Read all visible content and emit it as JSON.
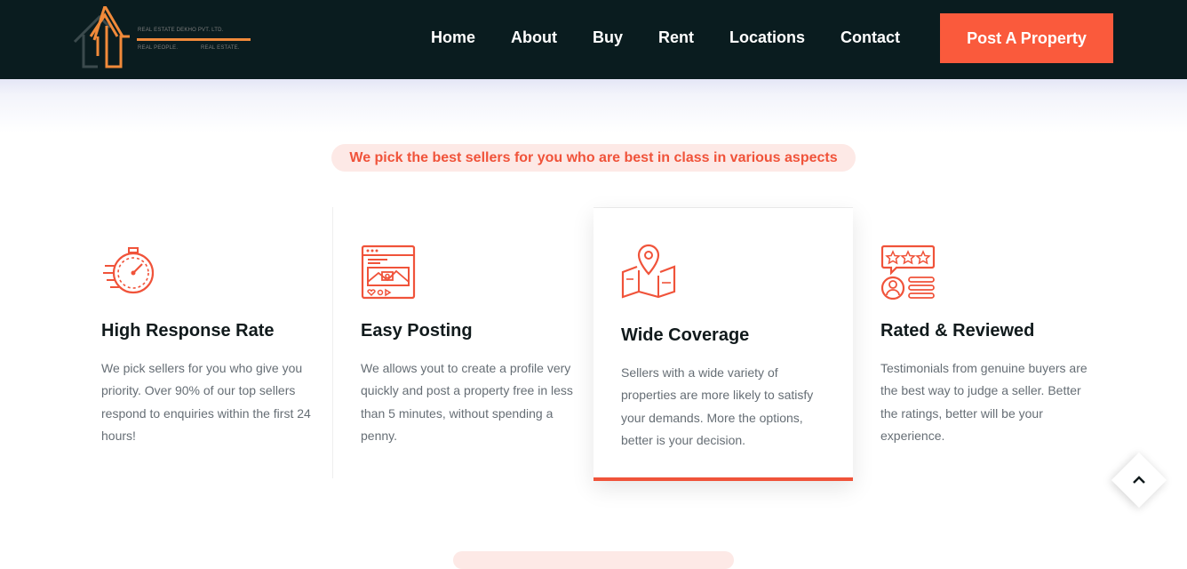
{
  "brand": {
    "company_name": "REAL ESTATE DEKHO PVT. LTD.",
    "tagline_left": "REAL PEOPLE.",
    "tagline_right": "REAL ESTATE.",
    "logo_icon": "house-arrow-icon",
    "accent_color": "#f18a3a"
  },
  "nav": {
    "links": [
      "Home",
      "About",
      "Buy",
      "Rent",
      "Locations",
      "Contact"
    ],
    "cta_label": "Post A Property",
    "cta_color": "#fa5a3c",
    "background": "#0a1c1f"
  },
  "section": {
    "badge": "We pick the best sellers for you who are best in class in various aspects"
  },
  "features": [
    {
      "icon": "stopwatch-speed-icon",
      "title": "High Response Rate",
      "text": "We pick sellers for you who give you priority. Over 90% of our top sellers respond to enquiries within the first 24 hours!"
    },
    {
      "icon": "browser-post-icon",
      "title": "Easy Posting",
      "text": "We allows yout to create a profile very quickly and post a property free in less than 5 minutes, without spending a penny."
    },
    {
      "icon": "map-pin-icon",
      "title": "Wide Coverage",
      "text": "Sellers with a wide variety of properties are more likely to satisfy your demands. More the options, better is your decision."
    },
    {
      "icon": "rating-review-icon",
      "title": "Rated & Reviewed",
      "text": "Testimonials from genuine buyers are the best way to judge a seller. Better the ratings, better will be your experience."
    }
  ],
  "scroll_top_icon": "chevron-up-icon",
  "accent": "#f0533a"
}
